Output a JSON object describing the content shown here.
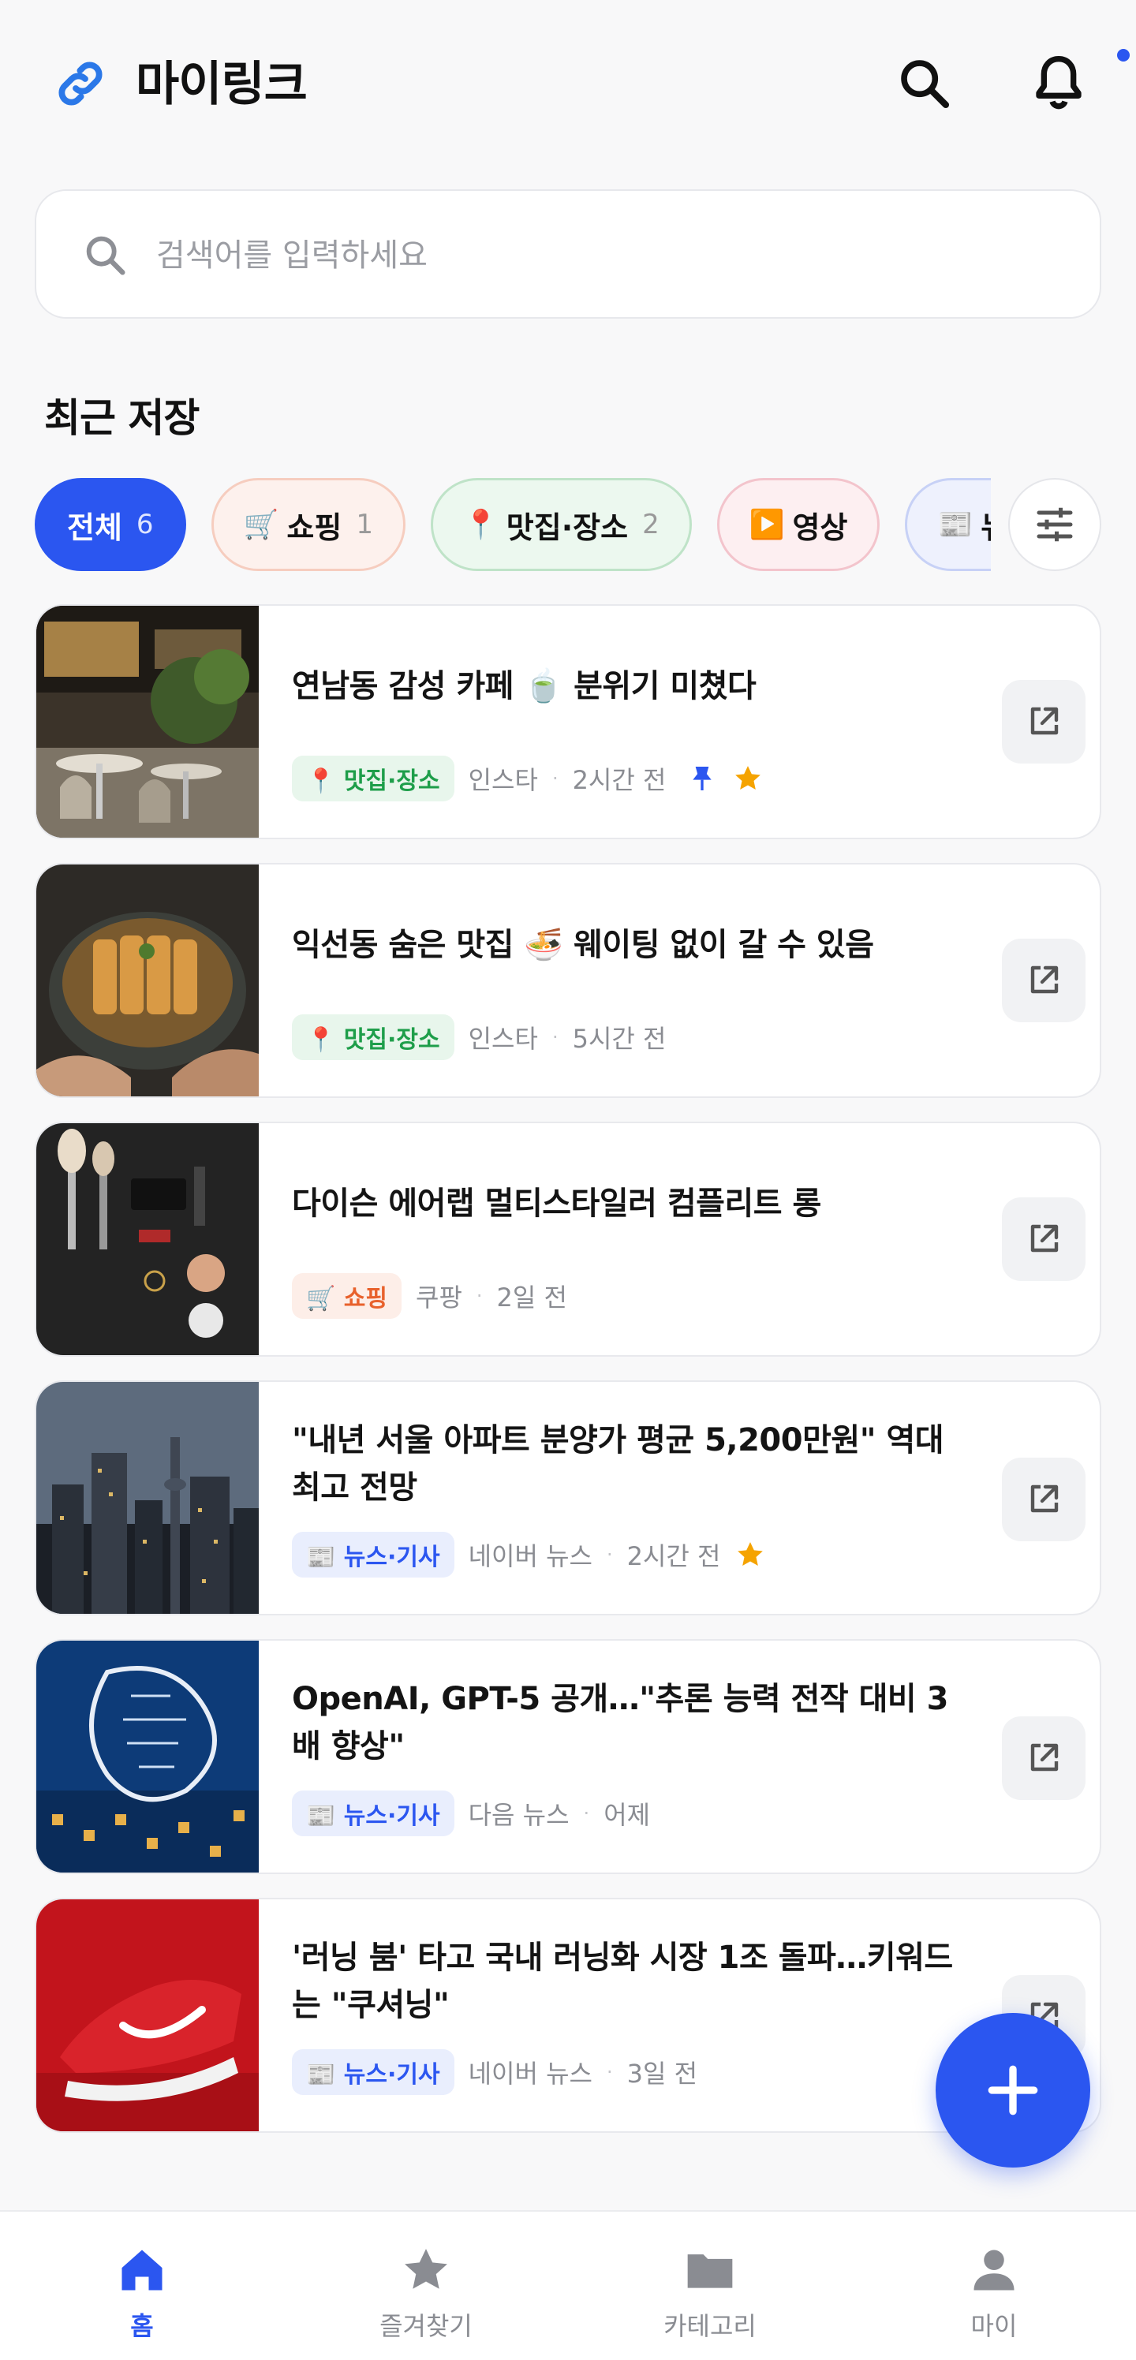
{
  "header": {
    "title": "마이링크",
    "icons": [
      "link-icon",
      "search-icon",
      "bell-icon"
    ],
    "has_notification": true
  },
  "search": {
    "placeholder": "검색어를 입력하세요"
  },
  "section_title": "최근 저장",
  "chips": [
    {
      "label": "전체",
      "count": "6",
      "emoji": "",
      "active": true
    },
    {
      "label": "쇼핑",
      "count": "1",
      "emoji": "🛒",
      "active": false
    },
    {
      "label": "맛집·장소",
      "count": "2",
      "emoji": "📍",
      "active": false
    },
    {
      "label": "영상",
      "count": "",
      "emoji": "▶️",
      "active": false
    },
    {
      "label": "뉴스·기사",
      "count": "",
      "emoji": "📰",
      "active": false
    }
  ],
  "cards": [
    {
      "title": "연남동 감성 카페 🍵 분위기 미쳤다",
      "tag": "📍 맛집·장소",
      "tag_type": "place",
      "source": "인스타",
      "time": "2시간 전",
      "pinned": true,
      "starred": true,
      "thumb": "cafe"
    },
    {
      "title": "익선동 숨은 맛집 🍜 웨이팅 없이 갈 수 있음",
      "tag": "📍 맛집·장소",
      "tag_type": "place",
      "source": "인스타",
      "time": "5시간 전",
      "pinned": false,
      "starred": false,
      "thumb": "food"
    },
    {
      "title": "다이슨 에어랩 멀티스타일러 컴플리트 롱",
      "tag": "🛒 쇼핑",
      "tag_type": "shopping",
      "source": "쿠팡",
      "time": "2일 전",
      "pinned": false,
      "starred": false,
      "thumb": "cosmetics"
    },
    {
      "title": "\"내년 서울 아파트 분양가 평균 5,200만원\" 역대 최고 전망",
      "tag": "📰 뉴스·기사",
      "tag_type": "news",
      "source": "네이버 뉴스",
      "time": "2시간 전",
      "pinned": false,
      "starred": true,
      "thumb": "city"
    },
    {
      "title": "OpenAI, GPT-5 공개…\"추론 능력 전작 대비 3배 향상\"",
      "tag": "📰 뉴스·기사",
      "tag_type": "news",
      "source": "다음 뉴스",
      "time": "어제",
      "pinned": false,
      "starred": false,
      "thumb": "ai"
    },
    {
      "title": "'러닝 붐' 타고 국내 러닝화 시장 1조 돌파…키워드는 \"쿠셔닝\"",
      "tag": "📰 뉴스·기사",
      "tag_type": "news",
      "source": "네이버 뉴스",
      "time": "3일 전",
      "pinned": false,
      "starred": false,
      "thumb": "shoe"
    }
  ],
  "bottom_nav": [
    {
      "label": "홈",
      "icon": "home-icon",
      "active": true
    },
    {
      "label": "즐겨찾기",
      "icon": "star-icon",
      "active": false
    },
    {
      "label": "카테고리",
      "icon": "folder-icon",
      "active": false
    },
    {
      "label": "마이",
      "icon": "person-icon",
      "active": false
    }
  ],
  "colors": {
    "accent": "#2b56f0",
    "place": "#1e9e4a",
    "shopping": "#e8612c",
    "news": "#2b56f0",
    "star": "#f5a300"
  }
}
